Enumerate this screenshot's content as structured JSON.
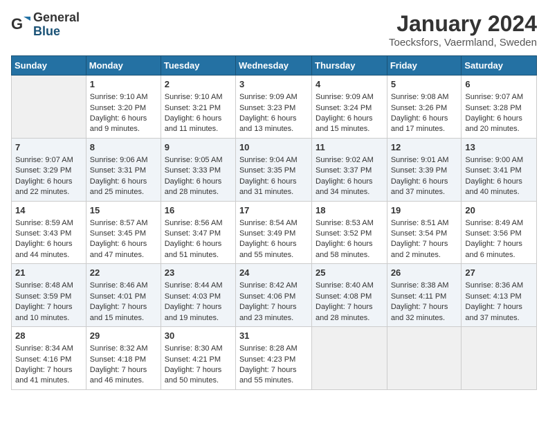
{
  "header": {
    "logo_general": "General",
    "logo_blue": "Blue",
    "month_title": "January 2024",
    "location": "Toecksfors, Vaermland, Sweden"
  },
  "calendar": {
    "days_of_week": [
      "Sunday",
      "Monday",
      "Tuesday",
      "Wednesday",
      "Thursday",
      "Friday",
      "Saturday"
    ],
    "weeks": [
      [
        {
          "day": "",
          "info": ""
        },
        {
          "day": "1",
          "info": "Sunrise: 9:10 AM\nSunset: 3:20 PM\nDaylight: 6 hours and 9 minutes."
        },
        {
          "day": "2",
          "info": "Sunrise: 9:10 AM\nSunset: 3:21 PM\nDaylight: 6 hours and 11 minutes."
        },
        {
          "day": "3",
          "info": "Sunrise: 9:09 AM\nSunset: 3:23 PM\nDaylight: 6 hours and 13 minutes."
        },
        {
          "day": "4",
          "info": "Sunrise: 9:09 AM\nSunset: 3:24 PM\nDaylight: 6 hours and 15 minutes."
        },
        {
          "day": "5",
          "info": "Sunrise: 9:08 AM\nSunset: 3:26 PM\nDaylight: 6 hours and 17 minutes."
        },
        {
          "day": "6",
          "info": "Sunrise: 9:07 AM\nSunset: 3:28 PM\nDaylight: 6 hours and 20 minutes."
        }
      ],
      [
        {
          "day": "7",
          "info": "Sunrise: 9:07 AM\nSunset: 3:29 PM\nDaylight: 6 hours and 22 minutes."
        },
        {
          "day": "8",
          "info": "Sunrise: 9:06 AM\nSunset: 3:31 PM\nDaylight: 6 hours and 25 minutes."
        },
        {
          "day": "9",
          "info": "Sunrise: 9:05 AM\nSunset: 3:33 PM\nDaylight: 6 hours and 28 minutes."
        },
        {
          "day": "10",
          "info": "Sunrise: 9:04 AM\nSunset: 3:35 PM\nDaylight: 6 hours and 31 minutes."
        },
        {
          "day": "11",
          "info": "Sunrise: 9:02 AM\nSunset: 3:37 PM\nDaylight: 6 hours and 34 minutes."
        },
        {
          "day": "12",
          "info": "Sunrise: 9:01 AM\nSunset: 3:39 PM\nDaylight: 6 hours and 37 minutes."
        },
        {
          "day": "13",
          "info": "Sunrise: 9:00 AM\nSunset: 3:41 PM\nDaylight: 6 hours and 40 minutes."
        }
      ],
      [
        {
          "day": "14",
          "info": "Sunrise: 8:59 AM\nSunset: 3:43 PM\nDaylight: 6 hours and 44 minutes."
        },
        {
          "day": "15",
          "info": "Sunrise: 8:57 AM\nSunset: 3:45 PM\nDaylight: 6 hours and 47 minutes."
        },
        {
          "day": "16",
          "info": "Sunrise: 8:56 AM\nSunset: 3:47 PM\nDaylight: 6 hours and 51 minutes."
        },
        {
          "day": "17",
          "info": "Sunrise: 8:54 AM\nSunset: 3:49 PM\nDaylight: 6 hours and 55 minutes."
        },
        {
          "day": "18",
          "info": "Sunrise: 8:53 AM\nSunset: 3:52 PM\nDaylight: 6 hours and 58 minutes."
        },
        {
          "day": "19",
          "info": "Sunrise: 8:51 AM\nSunset: 3:54 PM\nDaylight: 7 hours and 2 minutes."
        },
        {
          "day": "20",
          "info": "Sunrise: 8:49 AM\nSunset: 3:56 PM\nDaylight: 7 hours and 6 minutes."
        }
      ],
      [
        {
          "day": "21",
          "info": "Sunrise: 8:48 AM\nSunset: 3:59 PM\nDaylight: 7 hours and 10 minutes."
        },
        {
          "day": "22",
          "info": "Sunrise: 8:46 AM\nSunset: 4:01 PM\nDaylight: 7 hours and 15 minutes."
        },
        {
          "day": "23",
          "info": "Sunrise: 8:44 AM\nSunset: 4:03 PM\nDaylight: 7 hours and 19 minutes."
        },
        {
          "day": "24",
          "info": "Sunrise: 8:42 AM\nSunset: 4:06 PM\nDaylight: 7 hours and 23 minutes."
        },
        {
          "day": "25",
          "info": "Sunrise: 8:40 AM\nSunset: 4:08 PM\nDaylight: 7 hours and 28 minutes."
        },
        {
          "day": "26",
          "info": "Sunrise: 8:38 AM\nSunset: 4:11 PM\nDaylight: 7 hours and 32 minutes."
        },
        {
          "day": "27",
          "info": "Sunrise: 8:36 AM\nSunset: 4:13 PM\nDaylight: 7 hours and 37 minutes."
        }
      ],
      [
        {
          "day": "28",
          "info": "Sunrise: 8:34 AM\nSunset: 4:16 PM\nDaylight: 7 hours and 41 minutes."
        },
        {
          "day": "29",
          "info": "Sunrise: 8:32 AM\nSunset: 4:18 PM\nDaylight: 7 hours and 46 minutes."
        },
        {
          "day": "30",
          "info": "Sunrise: 8:30 AM\nSunset: 4:21 PM\nDaylight: 7 hours and 50 minutes."
        },
        {
          "day": "31",
          "info": "Sunrise: 8:28 AM\nSunset: 4:23 PM\nDaylight: 7 hours and 55 minutes."
        },
        {
          "day": "",
          "info": ""
        },
        {
          "day": "",
          "info": ""
        },
        {
          "day": "",
          "info": ""
        }
      ]
    ]
  }
}
